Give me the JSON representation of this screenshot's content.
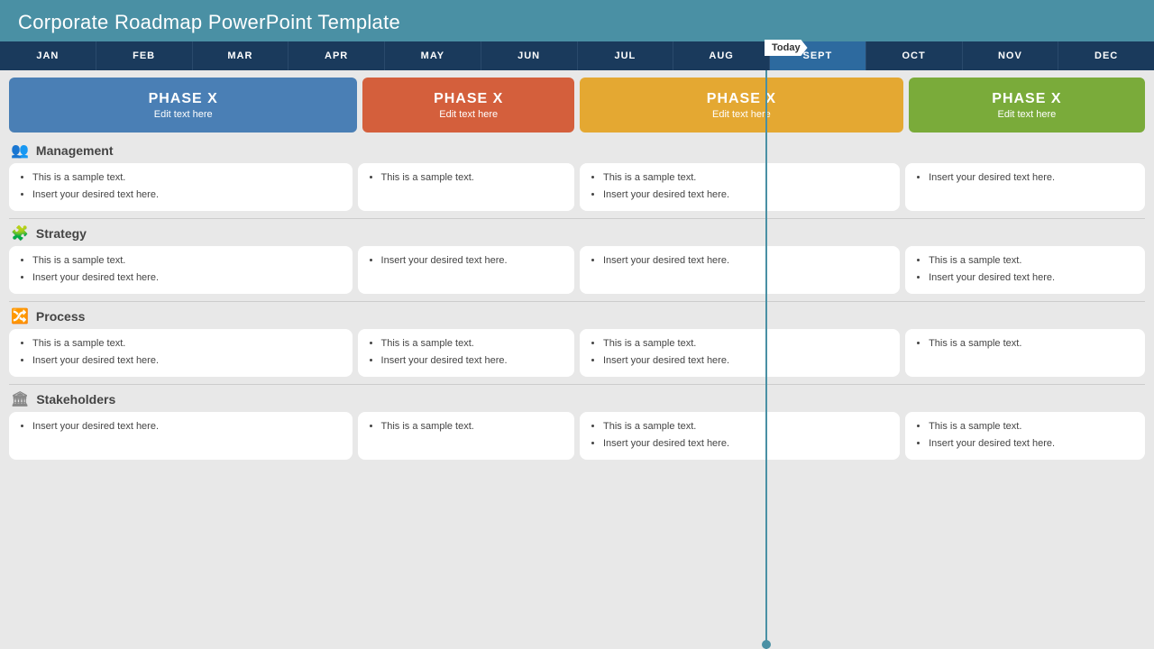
{
  "title": "Corporate Roadmap PowerPoint Template",
  "today_label": "Today",
  "months": [
    {
      "label": "JAN",
      "active": false
    },
    {
      "label": "FEB",
      "active": false
    },
    {
      "label": "MAR",
      "active": false
    },
    {
      "label": "APR",
      "active": false
    },
    {
      "label": "MAY",
      "active": false
    },
    {
      "label": "JUN",
      "active": false
    },
    {
      "label": "JUL",
      "active": false
    },
    {
      "label": "AUG",
      "active": false
    },
    {
      "label": "SEPT",
      "active": true
    },
    {
      "label": "OCT",
      "active": false
    },
    {
      "label": "NOV",
      "active": false
    },
    {
      "label": "DEC",
      "active": false
    }
  ],
  "phases": [
    {
      "label": "PHASE X",
      "sub": "Edit text here",
      "class": "phase-1"
    },
    {
      "label": "PHASE X",
      "sub": "Edit text here",
      "class": "phase-2"
    },
    {
      "label": "PHASE X",
      "sub": "Edit text here",
      "class": "phase-3"
    },
    {
      "label": "PHASE X",
      "sub": "Edit text here",
      "class": "phase-4"
    }
  ],
  "sections": [
    {
      "title": "Management",
      "icon": "👥",
      "cards": [
        {
          "items": [
            "This is a sample text.",
            "Insert your desired text here."
          ]
        },
        {
          "items": [
            "This is a sample text."
          ]
        },
        {
          "items": [
            "This is a sample text.",
            "Insert your desired text here."
          ]
        },
        {
          "items": [
            "Insert your desired text here."
          ]
        }
      ]
    },
    {
      "title": "Strategy",
      "icon": "🧩",
      "cards": [
        {
          "items": [
            "This is a sample text.",
            "Insert your desired text here."
          ]
        },
        {
          "items": [
            "Insert your desired text here."
          ]
        },
        {
          "items": [
            "Insert your desired text here."
          ]
        },
        {
          "items": [
            "This is a sample text.",
            "Insert your desired text here."
          ]
        }
      ]
    },
    {
      "title": "Process",
      "icon": "🔀",
      "cards": [
        {
          "items": [
            "This is a sample text.",
            "Insert your desired text here."
          ]
        },
        {
          "items": [
            "This is a sample text.",
            "Insert your desired text here."
          ]
        },
        {
          "items": [
            "This is a sample text.",
            "Insert your desired text here."
          ]
        },
        {
          "items": [
            "This is a sample text."
          ]
        }
      ]
    },
    {
      "title": "Stakeholders",
      "icon": "🏛",
      "cards": [
        {
          "items": [
            "Insert your desired text here."
          ]
        },
        {
          "items": [
            "This is a sample text."
          ]
        },
        {
          "items": [
            "This is a sample text.",
            "Insert your desired text here."
          ]
        },
        {
          "items": [
            "This is a sample text.",
            "Insert your desired text here."
          ]
        }
      ]
    }
  ]
}
